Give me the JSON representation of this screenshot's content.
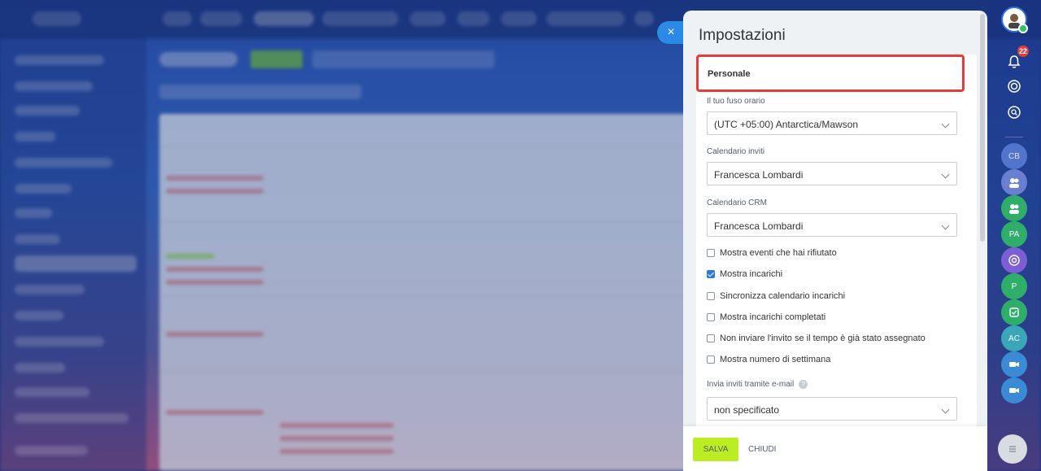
{
  "panel": {
    "title": "Impostazioni",
    "section_title": "Personale",
    "close_icon": "×"
  },
  "fields": [
    {
      "label": "Il tuo fuso orario",
      "value": "(UTC +05:00) Antarctica/Mawson"
    },
    {
      "label": "Calendario inviti",
      "value": "Francesca Lombardi"
    },
    {
      "label": "Calendario CRM",
      "value": "Francesca Lombardi"
    }
  ],
  "checkboxes": [
    {
      "label": "Mostra eventi che hai rifiutato",
      "checked": false
    },
    {
      "label": "Mostra incarichi",
      "checked": true
    },
    {
      "label": "Sincronizza calendario incarichi",
      "checked": false
    },
    {
      "label": "Mostra incarichi completati",
      "checked": false
    },
    {
      "label": "Non inviare l'invito se il tempo è già stato assegnato",
      "checked": false
    },
    {
      "label": "Mostra numero di settimana",
      "checked": false
    }
  ],
  "email_invites": {
    "label": "Invia inviti tramite e-mail",
    "help_icon": "?",
    "value": "non specificato"
  },
  "footer": {
    "save_label": "SALVA",
    "close_label": "CHIUDI"
  },
  "rail": {
    "notification_count": "22",
    "avatars": [
      "CB",
      "PA",
      "P",
      "AC"
    ]
  },
  "colors": {
    "accent_blue": "#2a8ae6",
    "save_green": "#bbed21",
    "highlight_red": "#e53b3b",
    "checkbox_blue": "#2a7ae0"
  }
}
